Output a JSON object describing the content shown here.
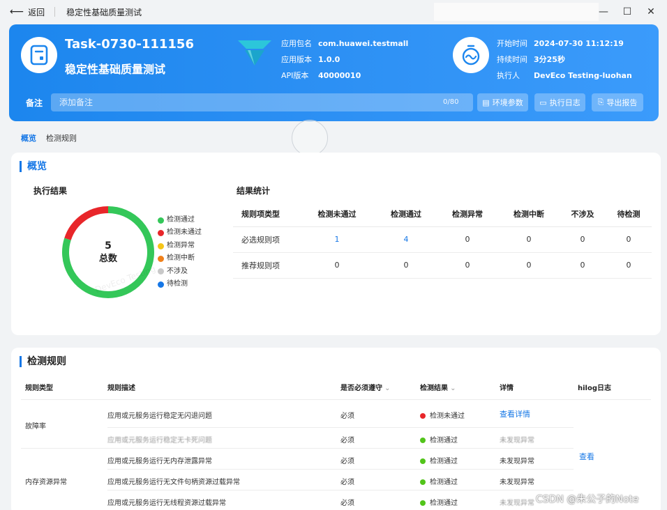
{
  "titlebar": {
    "back_label": "返回",
    "title": "稳定性基础质量测试",
    "controls": [
      "—",
      "☐",
      "✕"
    ]
  },
  "header": {
    "task_id": "Task-0730-111156",
    "task_name": "稳定性基础质量测试",
    "app_info": [
      {
        "key": "应用包名",
        "value": "com.huawei.testmall"
      },
      {
        "key": "应用版本",
        "value": "1.0.0"
      },
      {
        "key": "API版本",
        "value": "40000010"
      }
    ],
    "run_info": [
      {
        "key": "开始时间",
        "value": "2024-07-30 11:12:19"
      },
      {
        "key": "持续时间",
        "value": "3分25秒"
      },
      {
        "key": "执行人",
        "value": "DevEco Testing-luohan"
      }
    ],
    "note_label": "备注",
    "note_placeholder": "添加备注",
    "note_count": "0/80",
    "buttons": [
      {
        "label": "环境参数",
        "icon": "params-icon"
      },
      {
        "label": "执行日志",
        "icon": "log-icon"
      },
      {
        "label": "导出报告",
        "icon": "export-icon"
      }
    ]
  },
  "tabs": [
    "概览",
    "检测规则"
  ],
  "overview": {
    "title": "概览",
    "exec_title": "执行结果",
    "donut": {
      "total": "5",
      "total_label": "总数"
    },
    "legend": [
      {
        "label": "检测通过",
        "color": "#34c759"
      },
      {
        "label": "检测未通过",
        "color": "#e8262a"
      },
      {
        "label": "检测异常",
        "color": "#f5c518"
      },
      {
        "label": "检测中断",
        "color": "#f0801a"
      },
      {
        "label": "不涉及",
        "color": "#c8c8c8"
      },
      {
        "label": "待检测",
        "color": "#1677e6"
      }
    ],
    "watermark": "DevEco Testing",
    "stats_title": "结果统计",
    "stats_headers": [
      "规则项类型",
      "检测未通过",
      "检测通过",
      "检测异常",
      "检测中断",
      "不涉及",
      "待检测"
    ],
    "stats_rows": [
      [
        "必选规则项",
        "1",
        "4",
        "0",
        "0",
        "0",
        "0"
      ],
      [
        "推荐规则项",
        "0",
        "0",
        "0",
        "0",
        "0",
        "0"
      ]
    ]
  },
  "chart_data": {
    "type": "pie",
    "categories": [
      "检测通过",
      "检测未通过",
      "检测异常",
      "检测中断",
      "不涉及",
      "待检测"
    ],
    "values": [
      4,
      1,
      0,
      0,
      0,
      0
    ]
  },
  "rules": {
    "title": "检测规则",
    "headers": [
      "规则类型",
      "规则描述",
      "是否必须遵守",
      "检测结果",
      "详情",
      "hilog日志"
    ],
    "rows": [
      {
        "type": "故障率",
        "desc": "应用或元服务运行稳定无闪退问题",
        "required": "必须",
        "result": "检测未通过",
        "result_color": "#e8262a",
        "detail": "查看详情"
      },
      {
        "type": "",
        "desc": "应用或元服务运行稳定无卡死问题",
        "required": "必须",
        "result": "检测通过",
        "result_color": "#52c41a",
        "detail": "未发现异常"
      },
      {
        "type": "",
        "desc": "应用或元服务运行无内存泄露异常",
        "required": "必须",
        "result": "检测通过",
        "result_color": "#52c41a",
        "detail": "未发现异常"
      },
      {
        "type": "内存资源异常",
        "desc": "应用或元服务运行无文件句柄资源过载异常",
        "required": "必须",
        "result": "检测通过",
        "result_color": "#52c41a",
        "detail": "未发现异常"
      },
      {
        "type": "",
        "desc": "应用或元服务运行无线程资源过载异常",
        "required": "必须",
        "result": "检测通过",
        "result_color": "#52c41a",
        "detail": "未发现异常"
      }
    ],
    "hilog_link": "查看"
  },
  "watermark_corner": "CSDN @朱公子的Note"
}
